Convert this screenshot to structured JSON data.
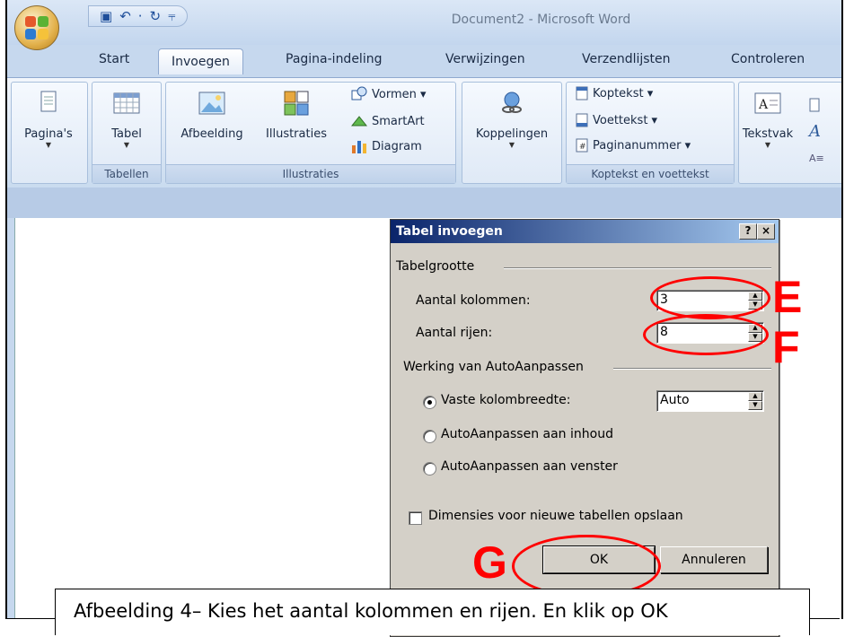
{
  "window": {
    "title": "Document2 - Microsoft Word"
  },
  "qat": {
    "save_icon": "▣",
    "undo_icon": "↶",
    "sep_icon": "·",
    "redo_icon": "↻",
    "more_icon": "⫧"
  },
  "tabs": [
    "Start",
    "Invoegen",
    "Pagina-indeling",
    "Verwijzingen",
    "Verzendlijsten",
    "Controleren"
  ],
  "ribbon": {
    "paginas": "Pagina's",
    "tabel": "Tabel",
    "tabellen_group": "Tabellen",
    "afbeelding": "Afbeelding",
    "illustraties": "Illustraties",
    "vormen": "Vormen ▾",
    "smartart": "SmartArt",
    "diagram": "Diagram",
    "illustraties_group": "Illustraties",
    "koppelingen": "Koppelingen",
    "koptekst": "Koptekst ▾",
    "voettekst": "Voettekst ▾",
    "paginanummer": "Paginanummer ▾",
    "kop_group": "Koptekst en voettekst",
    "tekstvak": "Tekstvak"
  },
  "dialog": {
    "title": "Tabel invoegen",
    "help": "?",
    "close": "×",
    "section1": "Tabelgrootte",
    "kolommen_label": "Aantal kolommen:",
    "kolommen_value": "3",
    "rijen_label": "Aantal rijen:",
    "rijen_value": "8",
    "section2": "Werking van AutoAanpassen",
    "opt_vaste": "Vaste kolombreedte:",
    "vaste_value": "Auto",
    "opt_inhoud": "AutoAanpassen aan inhoud",
    "opt_venster": "AutoAanpassen aan venster",
    "dimensies": "Dimensies voor nieuwe tabellen opslaan",
    "ok": "OK",
    "annuleren": "Annuleren"
  },
  "annotations": {
    "e": "E",
    "f": "F",
    "g": "G"
  },
  "caption": "Afbeelding 4– Kies het aantal kolommen en rijen. En klik op OK",
  "colors": {
    "annotation": "#ff0000",
    "dialog_title": "#0a246a"
  }
}
